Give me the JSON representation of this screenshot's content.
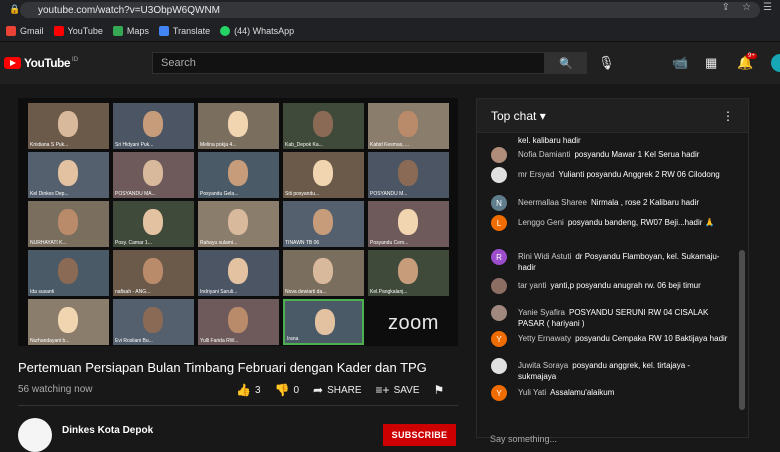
{
  "browser": {
    "url": "youtube.com/watch?v=U3ObpW6QWNM",
    "bookmarks": [
      {
        "label": "Gmail",
        "color": "#ea4335"
      },
      {
        "label": "YouTube",
        "color": "#ff0000"
      },
      {
        "label": "Maps",
        "color": "#34a853"
      },
      {
        "label": "Translate",
        "color": "#4285f4"
      },
      {
        "label": "(44) WhatsApp",
        "color": "#25d366"
      }
    ]
  },
  "header": {
    "logo": "YouTube",
    "logo_region": "ID",
    "search_placeholder": "Search",
    "notification_count": "9+"
  },
  "video": {
    "participants": [
      "Kristiana S Puk...",
      "Sri Hidyani Puk...",
      "Melina pokja 4...",
      "Kab_Depok Ka...",
      "Kabid Kesmas, ...",
      "Kel Dinkes Dep...",
      "POSYANDU MA...",
      "Posyandu Gela...",
      "Siti posyandu...",
      "POSYANDU M...",
      "NURHAYATI K...",
      "Posy. Camar 1...",
      "Rahayu sulami...",
      "TINAWN TB 06",
      "Posyandu Cem...",
      "Ida susanti",
      "nafisah - ANG...",
      "Indriyani Saruli...",
      "Nova dewiarti da...",
      "Kel.Pangkalanj...",
      "Nurhandayani b...",
      "Evi Rosliani Bu...",
      "Yulli Farida RW...",
      "Irana"
    ],
    "zoom_logo": "zoom",
    "title": "Pertemuan Persiapan Bulan Timbang Februari dengan Kader dan TPG",
    "views": "56 watching now",
    "likes": "3",
    "dislikes": "0",
    "share_label": "SHARE",
    "save_label": "SAVE",
    "channel_name": "Dinkes Kota Depok",
    "subscribe_label": "SUBSCRIBE"
  },
  "chat": {
    "title": "Top chat",
    "messages": [
      {
        "author": "",
        "text": "kel. kalibaru hadir",
        "avatar_color": "#181818",
        "initial": ""
      },
      {
        "author": "Nofia Damianti",
        "text": "posyandu Mawar 1 Kel Serua hadir",
        "avatar_color": "#b08c7a",
        "initial": ""
      },
      {
        "author": "mr Ersyad",
        "text": "Yulianti posyandu Anggrek 2 RW 06 Cilodong",
        "avatar_color": "#e0e0e0",
        "initial": ""
      },
      {
        "author": "Neermallaa Sharee",
        "text": "Nirmala , rose 2 Kalibaru hadir",
        "avatar_color": "#607d8b",
        "initial": "N"
      },
      {
        "author": "Lenggo Geni",
        "text": "posyandu bandeng, RW07 Beji...hadir 🙏",
        "avatar_color": "#ef6c00",
        "initial": "L"
      },
      {
        "author": "Rini Widi Astuti",
        "text": "dr Posyandu Flamboyan, kel. Sukamaju- hadir",
        "avatar_color": "#9c4dcc",
        "initial": "R"
      },
      {
        "author": "tar yanti",
        "text": "yanti,p posyandu anugrah rw. 06 beji timur",
        "avatar_color": "#8d6e63",
        "initial": ""
      },
      {
        "author": "Yanie Syafira",
        "text": "POSYANDU SERUNI RW 04 CISALAK PASAR ( hariyani )",
        "avatar_color": "#a1887f",
        "initial": ""
      },
      {
        "author": "Yetty Ernawaty",
        "text": "posyandu Cempaka RW 10 Baktijaya hadir",
        "avatar_color": "#ef6c00",
        "initial": "Y"
      },
      {
        "author": "Juwita Soraya",
        "text": "posyandu anggrek, kel. tirtajaya - sukmajaya",
        "avatar_color": "#e0e0e0",
        "initial": ""
      },
      {
        "author": "Yuli Yati",
        "text": "Assalamu'alaikum",
        "avatar_color": "#ef6c00",
        "initial": "Y"
      }
    ],
    "footer": "Say something..."
  }
}
